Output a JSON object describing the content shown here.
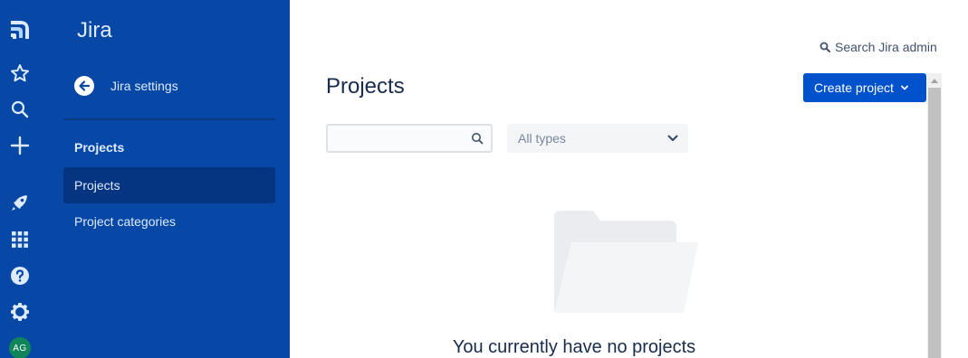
{
  "colors": {
    "nav_bg": "#0747a6",
    "nav_selected": "#053480",
    "primary_button": "#0052cc",
    "avatar": "#10855a"
  },
  "global_nav": {
    "items": [
      {
        "icon": "jira-logo-icon"
      },
      {
        "icon": "star-icon"
      },
      {
        "icon": "search-icon"
      },
      {
        "icon": "plus-icon"
      },
      {
        "icon": "rocket-icon"
      },
      {
        "icon": "app-switcher-icon"
      },
      {
        "icon": "help-icon"
      },
      {
        "icon": "gear-icon"
      }
    ],
    "avatar_initials": "AG"
  },
  "sidebar": {
    "product_title": "Jira",
    "back_label": "Jira settings",
    "group_heading": "Projects",
    "items": [
      {
        "label": "Projects",
        "selected": true
      },
      {
        "label": "Project categories",
        "selected": false
      }
    ]
  },
  "header": {
    "admin_search_label": "Search Jira admin",
    "title": "Projects",
    "create_button_label": "Create project"
  },
  "filters": {
    "search_value": "",
    "search_placeholder": "",
    "type_selected": "All types"
  },
  "empty_state": {
    "message": "You currently have no projects",
    "icon": "empty-folder-illustration"
  }
}
